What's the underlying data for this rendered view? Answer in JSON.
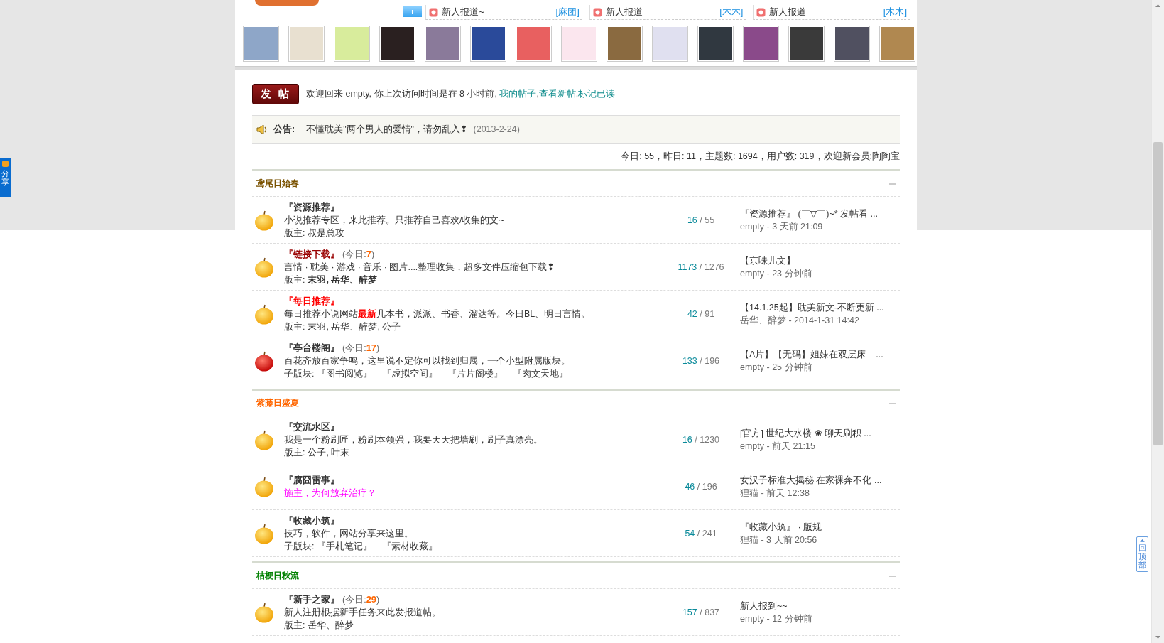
{
  "top_news": [
    {
      "title": "新人报道~",
      "author": "[麻团]"
    },
    {
      "title": "新人报道",
      "author": "[木木]"
    },
    {
      "title": "新人报道",
      "author": "[木木]"
    }
  ],
  "avatars": [
    {
      "kind": "photo"
    },
    {
      "kind": "photo"
    },
    {
      "kind": "photo"
    },
    {
      "kind": "photo"
    },
    {
      "kind": "photo"
    },
    {
      "kind": "photo"
    },
    {
      "kind": "photo"
    },
    {
      "kind": "photo"
    },
    {
      "kind": "photo"
    },
    {
      "kind": "photo"
    },
    {
      "kind": "photo"
    },
    {
      "kind": "photo"
    },
    {
      "kind": "photo"
    },
    {
      "kind": "photo"
    },
    {
      "kind": "photo"
    }
  ],
  "post_button": "发 帖",
  "welcome": {
    "text": "欢迎回来 empty, 你上次访问时间是在 8 小时前, ",
    "links": [
      "我的帖子",
      "查看新帖",
      "标记已读"
    ],
    "separator": ","
  },
  "count_separator": "/",
  "announcement": {
    "label": "公告:",
    "text": "不懂耽美\"两个男人的爱情\"，请勿乱入❢",
    "date": "(2013-2-24)"
  },
  "stats": "今日: 55，昨日: 11，主题数: 1694，用户数: 319，欢迎新会员:陶陶宝",
  "sections": [
    {
      "title": "鸢尾日始春",
      "color": "#7a5200",
      "forums": [
        {
          "title": "『资源推荐』",
          "color": "#333333",
          "new": false,
          "description": [
            {
              "text": "小说推荐专区，来此推荐。只推荐自己喜欢/收集的文~",
              "color": "#333333"
            }
          ],
          "footer": {
            "kind": "moderators",
            "label": "版主:",
            "names": "叔是总攻",
            "bold": false
          },
          "topics": "16",
          "posts": "55",
          "last_post": {
            "title": "『资源推荐』 (￣▽￣)~* 发帖看 ...",
            "byline": "empty - 3 天前 21:09"
          }
        },
        {
          "title": "『链接下载』",
          "color": "#990000",
          "new": false,
          "today": {
            "prefix": "(今日:",
            "count": "7",
            "suffix": ")"
          },
          "description": [
            {
              "text": "言情 · 耽美 · 游戏 · 音乐 · 图片....整理收集，超多文件压缩包下载❢",
              "color": "#333333"
            }
          ],
          "footer": {
            "kind": "moderators",
            "label": "版主:",
            "names": "末羽, 岳华、醉梦",
            "bold": true
          },
          "topics": "1173",
          "posts": "1276",
          "last_post": {
            "title": "【京味儿文】",
            "byline": "empty - 23 分钟前"
          }
        },
        {
          "title": "『每日推荐』",
          "color": "#ff0000",
          "new": false,
          "description": [
            {
              "text": "每日推荐小说网站",
              "color": "#333333"
            },
            {
              "text": "最新",
              "color": "#ff0000"
            },
            {
              "text": "几本书，派派、书香、溜达等。今日BL、明日言情。",
              "color": "#333333"
            }
          ],
          "footer": {
            "kind": "moderators",
            "label": "版主:",
            "names": "末羽, 岳华、醉梦, 公子",
            "bold": false
          },
          "topics": "42",
          "posts": "91",
          "last_post": {
            "title": "【14.1.25起】耽美新文-不断更新 ...",
            "byline": "岳华、醉梦 - 2014-1-31 14:42"
          }
        },
        {
          "title": "『亭台楼阁』",
          "color": "#333333",
          "new": true,
          "today": {
            "prefix": "(今日:",
            "count": "17",
            "suffix": ")"
          },
          "description": [
            {
              "text": "百花齐放百家争鸣，这里说不定你可以找到归属，一个小型附属版块。",
              "color": "#333333"
            }
          ],
          "footer": {
            "kind": "subforums",
            "label": "子版块:",
            "links": [
              "『图书阅览』",
              "『虚拟空间』",
              "『片片阁楼』",
              "『肉文天地』"
            ]
          },
          "topics": "133",
          "posts": "196",
          "last_post": {
            "title": "【A片】【无码】姐妹在双层床 – ...",
            "byline": "empty - 25 分钟前"
          }
        }
      ]
    },
    {
      "title": "紫藤日盛夏",
      "color": "#ff6600",
      "forums": [
        {
          "title": "『交流水区』",
          "color": "#333333",
          "new": false,
          "description": [
            {
              "text": "我是一个粉刷匠，粉刷本领强，我要天天把墙刷，刷子真漂亮。",
              "color": "#333333"
            }
          ],
          "footer": {
            "kind": "moderators",
            "label": "版主:",
            "names": "公子, 叶末",
            "bold": false
          },
          "topics": "16",
          "posts": "1230",
          "last_post": {
            "title": "[官方] 世纪大水楼 ❀ 聊天刷积 ...",
            "byline": "empty - 前天 21:15"
          }
        },
        {
          "title": "『腐囧雷事』",
          "color": "#333333",
          "new": false,
          "description": [
            {
              "text": "施主，为何放弃治疗？",
              "color": "#ff00ff"
            }
          ],
          "topics": "46",
          "posts": "196",
          "last_post": {
            "title": "女汉子标准大揭秘 在家裸奔不化 ...",
            "byline": "狸猫 - 前天 12:38"
          }
        },
        {
          "title": "『收藏小筑』",
          "color": "#333333",
          "new": false,
          "description": [
            {
              "text": "技巧，软件，网站分享来这里。",
              "color": "#333333"
            }
          ],
          "footer": {
            "kind": "subforums",
            "label": "子版块:",
            "links": [
              "『手札笔记』",
              "『素材收藏』"
            ]
          },
          "topics": "54",
          "posts": "241",
          "last_post": {
            "title": "『收藏小筑』 · 版规",
            "byline": "狸猫 - 3 天前 20:56"
          }
        }
      ]
    },
    {
      "title": "桔梗日秋流",
      "color": "#008000",
      "forums": [
        {
          "title": "『新手之家』",
          "color": "#333333",
          "new": false,
          "today": {
            "prefix": "(今日:",
            "count": "29",
            "suffix": ")"
          },
          "description": [
            {
              "text": "新人注册根据新手任务来此发报道帖。",
              "color": "#333333"
            }
          ],
          "footer": {
            "kind": "moderators",
            "label": "版主:",
            "names": "岳华、醉梦",
            "bold": false
          },
          "topics": "157",
          "posts": "837",
          "last_post": {
            "title": "新人报到~~",
            "byline": "empty - 12 分钟前"
          }
        }
      ]
    }
  ],
  "share": "分享",
  "back_to_top": "回顶部"
}
